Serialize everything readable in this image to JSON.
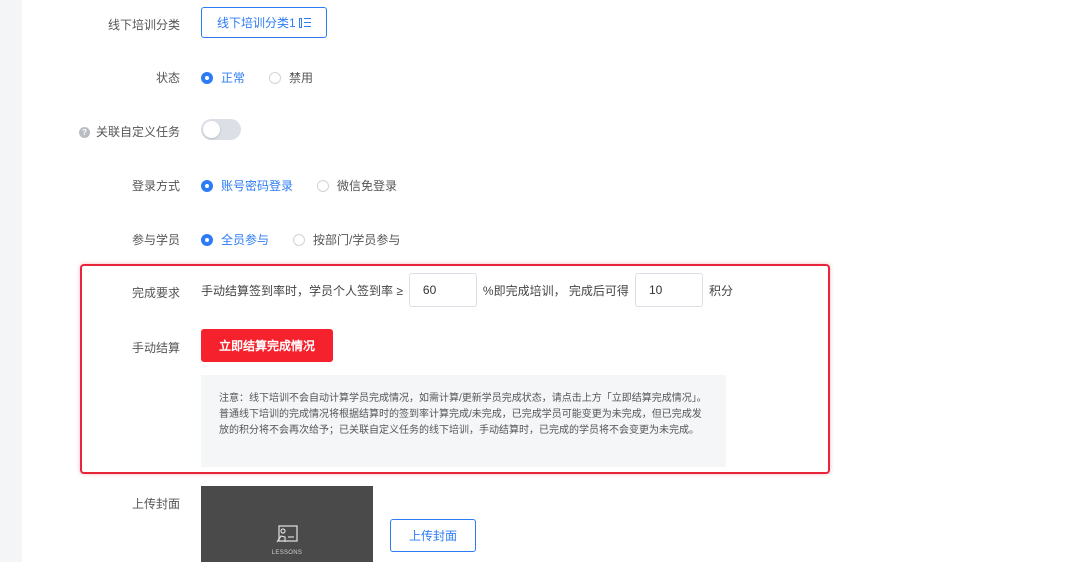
{
  "form": {
    "category": {
      "label": "线下培训分类",
      "button": "线下培训分类1"
    },
    "status": {
      "label": "状态",
      "options": [
        {
          "text": "正常",
          "checked": true
        },
        {
          "text": "禁用",
          "checked": false
        }
      ]
    },
    "custom_task": {
      "label": "关联自定义任务",
      "enabled": false
    },
    "login": {
      "label": "登录方式",
      "options": [
        {
          "text": "账号密码登录",
          "checked": true
        },
        {
          "text": "微信免登录",
          "checked": false
        }
      ]
    },
    "participants": {
      "label": "参与学员",
      "options": [
        {
          "text": "全员参与",
          "checked": true
        },
        {
          "text": "按部门/学员参与",
          "checked": false
        }
      ]
    },
    "completion": {
      "label": "完成要求",
      "text_before": "手动结算签到率时，学员个人签到率 ≥",
      "rate_value": "60",
      "text_middle": "%即完成培训， 完成后可得",
      "points_value": "10",
      "text_after": "积分"
    },
    "manual_settle": {
      "label": "手动结算",
      "button": "立即结算完成情况",
      "notice": "注意：线下培训不会自动计算学员完成情况，如需计算/更新学员完成状态，请点击上方「立即结算完成情况」。普通线下培训的完成情况将根据结算时的签到率计算完成/未完成，已完成学员可能变更为未完成，但已完成发放的积分将不会再次给予；已关联自定义任务的线下培训，手动结算时，已完成的学员将不会变更为未完成。"
    },
    "cover": {
      "label": "上传封面",
      "image_text": "LESSONS",
      "button": "上传封面"
    }
  },
  "colors": {
    "primary": "#2d7cf6",
    "danger": "#f5222d",
    "highlight_border": "#e8243a"
  }
}
